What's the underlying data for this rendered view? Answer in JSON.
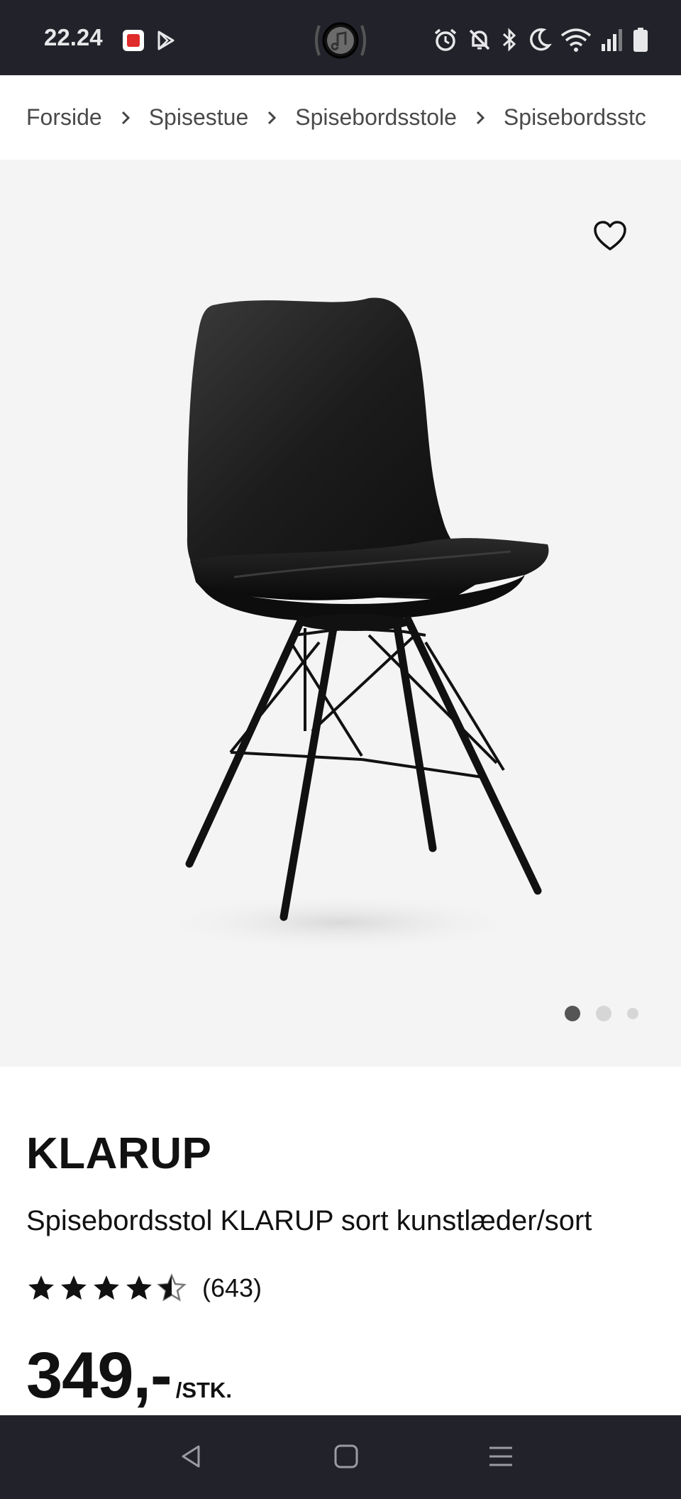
{
  "status_bar": {
    "time": "22.24",
    "icons": [
      "pdf-app-icon",
      "play-store-icon",
      "media-playing-icon",
      "alarm-icon",
      "mute-icon",
      "bluetooth-icon",
      "dnd-moon-icon",
      "wifi-icon",
      "signal-icon",
      "battery-icon"
    ]
  },
  "breadcrumb": {
    "items": [
      "Forside",
      "Spisestue",
      "Spisebordsstole",
      "Spisebordsstc"
    ],
    "separator_icon": "chevron-right-icon"
  },
  "gallery": {
    "image_alt": "Spisebordsstol KLARUP sort",
    "slide_count": 3,
    "active_slide": 1,
    "wishlist_icon": "heart-icon"
  },
  "product": {
    "name": "KLARUP",
    "description": "Spisebordsstol KLARUP sort kunstlæder/sort",
    "rating": 4.5,
    "rating_count": "(643)",
    "price": "349,-",
    "unit": "/STK."
  },
  "nav_bar": {
    "icons": [
      "back-icon",
      "home-icon",
      "recents-icon"
    ]
  },
  "colors": {
    "system_bar": "#22232a",
    "gallery_bg": "#f4f4f4",
    "text": "#111111",
    "breadcrumb_text": "#4a4a4a"
  }
}
